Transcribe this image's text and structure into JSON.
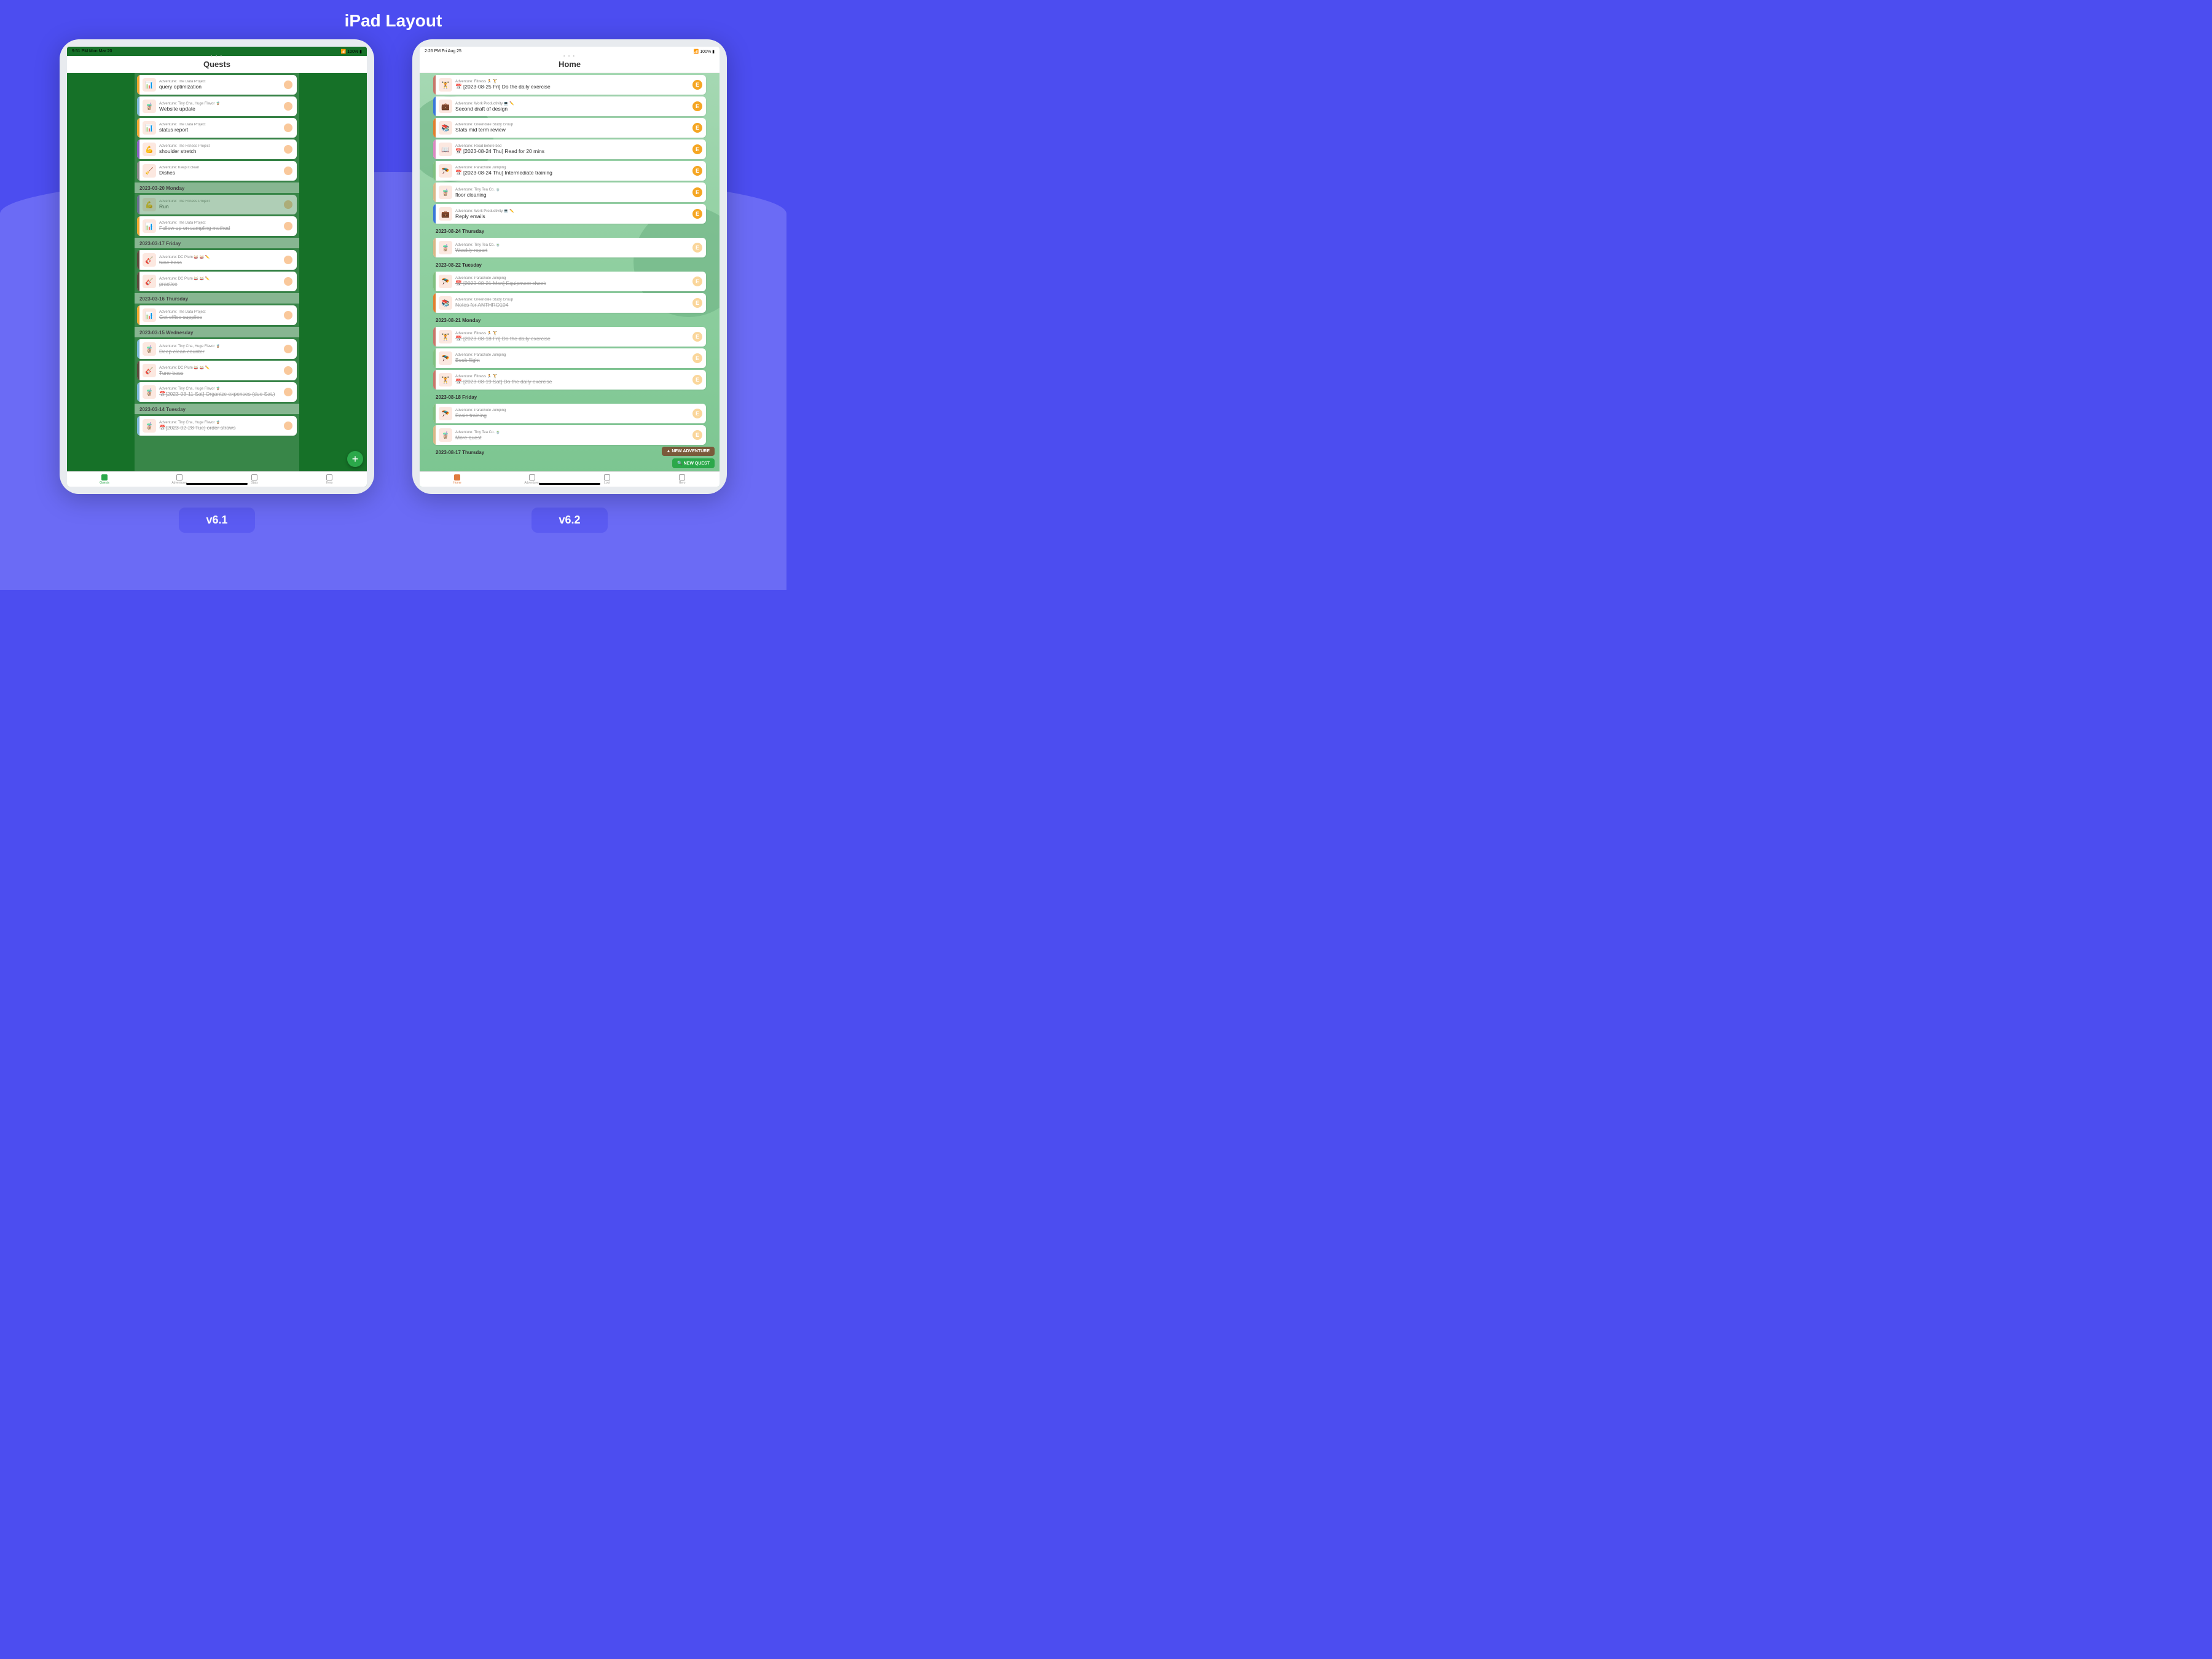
{
  "pageTitle": "iPad Layout",
  "left": {
    "version": "v6.1",
    "statusTime": "9:51 PM  Mon Mar 20",
    "statusBatt": "📶 100% ▮",
    "header": "Quests",
    "tabs": [
      "Quests",
      "Adventures",
      "Stats",
      "Hero"
    ],
    "fab": "+",
    "sections": [
      {
        "header": "",
        "items": [
          {
            "stripe": "#f0a830",
            "icon": "📊",
            "adv": "Adventure: The Data Project",
            "title": "query optimization"
          },
          {
            "stripe": "#7bb8d8",
            "icon": "🧋",
            "adv": "Adventure: Tiny Cha, Huge Flavor 🧋",
            "title": "Website update"
          },
          {
            "stripe": "#f0a830",
            "icon": "📊",
            "adv": "Adventure: The Data Project",
            "title": "status report"
          },
          {
            "stripe": "#8860c0",
            "icon": "💪",
            "adv": "Adventure: The Fitness Project",
            "title": "shoulder stretch"
          },
          {
            "stripe": "#888",
            "icon": "🧹",
            "adv": "Adventure: Keep it clean",
            "title": "Dishes"
          }
        ]
      },
      {
        "header": "2023-03-20 Monday",
        "items": [
          {
            "stripe": "#8860c0",
            "icon": "💪",
            "adv": "Adventure: The Fitness Project",
            "title": "Run",
            "dim": true
          },
          {
            "stripe": "#f0a830",
            "icon": "📊",
            "adv": "Adventure: The Data Project",
            "title": "Follow up on sampling method",
            "strike": true
          }
        ]
      },
      {
        "header": "2023-03-17 Friday",
        "items": [
          {
            "stripe": "#5a4a3a",
            "icon": "🎸",
            "adv": "Adventure: DC Plum 🥁 🥁 ✏️",
            "title": "tune bass",
            "strike": true
          },
          {
            "stripe": "#5a4a3a",
            "icon": "🎸",
            "adv": "Adventure: DC Plum 🥁 🥁 ✏️",
            "title": "practice",
            "strike": true
          }
        ]
      },
      {
        "header": "2023-03-16 Thursday",
        "items": [
          {
            "stripe": "#f0a830",
            "icon": "📊",
            "adv": "Adventure: The Data Project",
            "title": "Get office supplies",
            "strike": true
          }
        ]
      },
      {
        "header": "2023-03-15 Wednesday",
        "items": [
          {
            "stripe": "#7bb8d8",
            "icon": "🧋",
            "adv": "Adventure: Tiny Cha, Huge Flavor 🧋",
            "title": "Deep clean counter",
            "strike": true
          },
          {
            "stripe": "#5a4a3a",
            "icon": "🎸",
            "adv": "Adventure: DC Plum 🥁 🥁 ✏️",
            "title": "Tune bass",
            "strike": true
          },
          {
            "stripe": "#7bb8d8",
            "icon": "🧋",
            "adv": "Adventure: Tiny Cha, Huge Flavor 🧋",
            "title": "📅[2023-03-11 Sat] Organize expenses (due Sat.)",
            "strike": true
          }
        ]
      },
      {
        "header": "2023-03-14 Tuesday",
        "items": [
          {
            "stripe": "#7bb8d8",
            "icon": "🧋",
            "adv": "Adventure: Tiny Cha, Huge Flavor 🧋",
            "title": "📅[2023-02-28 Tue] order straws",
            "strike": true
          }
        ]
      }
    ]
  },
  "right": {
    "version": "v6.2",
    "statusTime": "2:26 PM  Fri Aug 25",
    "statusBatt": "📶 100% ▮",
    "header": "Home",
    "tabs": [
      "Home",
      "Adventures",
      "Loot",
      "Hero"
    ],
    "btnAdv": "▲ NEW ADVENTURE",
    "btnQuest": "🔍 NEW QUEST",
    "sections": [
      {
        "header": "",
        "items": [
          {
            "stripe": "#c7786a",
            "icon": "🏋️",
            "adv": "Adventure: Fitness 🏃 🏋️",
            "title": "📅 [2023-08-25 Fri] Do the daily exercise"
          },
          {
            "stripe": "#3a78d8",
            "icon": "💼",
            "adv": "Adventure: Work Productivity 💻 ✏️",
            "title": "Second draft of design"
          },
          {
            "stripe": "#e08030",
            "icon": "📚",
            "adv": "Adventure: Greendale Study Group",
            "title": "Stats mid term review"
          },
          {
            "stripe": "#d88ac0",
            "icon": "📖",
            "adv": "Adventure: Read before bed",
            "title": "📅 [2023-08-24 Thu] Read for 20 mins"
          },
          {
            "stripe": "#80c080",
            "icon": "🪂",
            "adv": "Adventure: Parachute Jumping",
            "title": "📅 [2023-08-24 Thu] Intermediate training"
          },
          {
            "stripe": "#d8b888",
            "icon": "🧋",
            "adv": "Adventure: Tiny Tea Co. 🍵",
            "title": "floor cleaning"
          },
          {
            "stripe": "#3a78d8",
            "icon": "💼",
            "adv": "Adventure: Work Productivity 💻 ✏️",
            "title": "Reply emails"
          }
        ]
      },
      {
        "header": "2023-08-24 Thursday",
        "items": [
          {
            "stripe": "#d8b888",
            "icon": "🧋",
            "adv": "Adventure: Tiny Tea Co. 🍵",
            "title": "Weekly report",
            "strike": true,
            "dimBadge": true
          }
        ]
      },
      {
        "header": "2023-08-22 Tuesday",
        "items": [
          {
            "stripe": "#80c080",
            "icon": "🪂",
            "adv": "Adventure: Parachute Jumping",
            "title": "📅 [2023-08-21 Mon] Equipment check",
            "strike": true,
            "dimBadge": true
          },
          {
            "stripe": "#e08030",
            "icon": "📚",
            "adv": "Adventure: Greendale Study Group",
            "title": "Notes for ANTHRO104",
            "strike": true,
            "dimBadge": true
          }
        ]
      },
      {
        "header": "2023-08-21 Monday",
        "items": [
          {
            "stripe": "#c7786a",
            "icon": "🏋️",
            "adv": "Adventure: Fitness 🏃 🏋️",
            "title": "📅 [2023-08-18 Fri] Do the daily exercise",
            "strike": true,
            "dimBadge": true
          },
          {
            "stripe": "#80c080",
            "icon": "🪂",
            "adv": "Adventure: Parachute Jumping",
            "title": "Book flight",
            "strike": true,
            "dimBadge": true
          },
          {
            "stripe": "#c7786a",
            "icon": "🏋️",
            "adv": "Adventure: Fitness 🏃 🏋️",
            "title": "📅 [2023-08-19 Sat] Do the daily exercise",
            "strike": true,
            "dimBadge": true
          }
        ]
      },
      {
        "header": "2023-08-18 Friday",
        "items": [
          {
            "stripe": "#80c080",
            "icon": "🪂",
            "adv": "Adventure: Parachute Jumping",
            "title": "Basic training",
            "strike": true,
            "dimBadge": true
          },
          {
            "stripe": "#d8b888",
            "icon": "🧋",
            "adv": "Adventure: Tiny Tea Co. 🍵",
            "title": "More quest",
            "strike": true,
            "dimBadge": true
          }
        ]
      },
      {
        "header": "2023-08-17 Thursday",
        "items": []
      }
    ]
  }
}
